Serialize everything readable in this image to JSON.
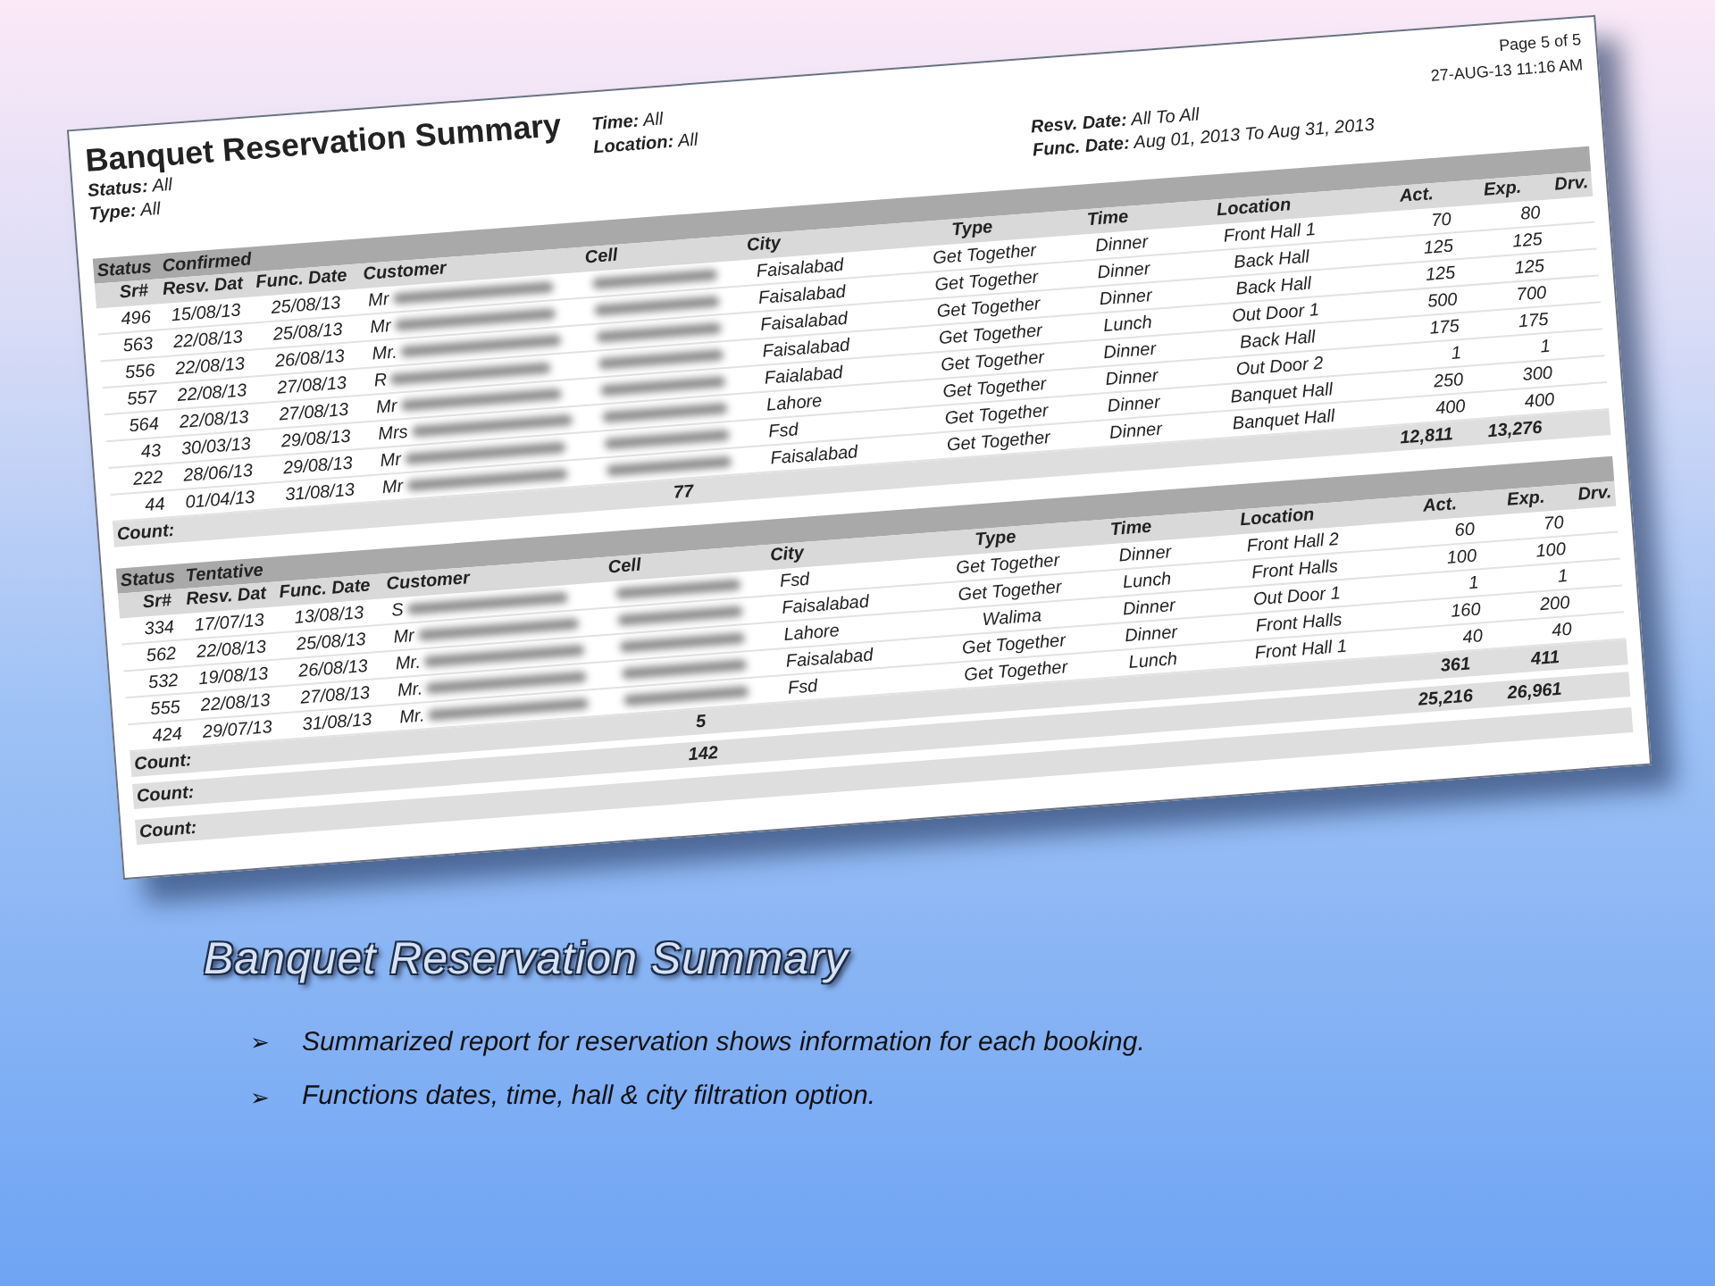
{
  "report": {
    "title": "Banquet Reservation Summary",
    "filters_left": [
      "**Status:** All",
      "**Type:** All"
    ],
    "filters_middle": [
      "**Time:** All",
      "**Location:** All"
    ],
    "filters_right": [
      "**Resv. Date:** All To All",
      "**Func. Date:** Aug 01, 2013 To Aug 31, 2013"
    ],
    "page": "Page 5 of 5",
    "printed": "27-AUG-13 11:16 AM",
    "groups": [
      {
        "status_label": "Status",
        "status": "Confirmed",
        "columns": [
          "Sr#",
          "Resv. Dat",
          "Func. Date",
          "Customer",
          "Cell",
          "City",
          "Type",
          "Time",
          "Location",
          "Act.",
          "Exp.",
          "Drv."
        ],
        "rows": [
          {
            "sr": "496",
            "resv": "15/08/13",
            "func": "25/08/13",
            "customer_prefix": "Mr",
            "city": "Faisalabad",
            "type": "Get Together",
            "time": "Dinner",
            "location": "Front Hall 1",
            "act": "70",
            "exp": "80"
          },
          {
            "sr": "563",
            "resv": "22/08/13",
            "func": "25/08/13",
            "customer_prefix": "Mr",
            "city": "Faisalabad",
            "type": "Get Together",
            "time": "Dinner",
            "location": "Back Hall",
            "act": "125",
            "exp": "125"
          },
          {
            "sr": "556",
            "resv": "22/08/13",
            "func": "26/08/13",
            "customer_prefix": "Mr.",
            "city": "Faisalabad",
            "type": "Get Together",
            "time": "Dinner",
            "location": "Back Hall",
            "act": "125",
            "exp": "125"
          },
          {
            "sr": "557",
            "resv": "22/08/13",
            "func": "27/08/13",
            "customer_prefix": "R",
            "city": "Faisalabad",
            "type": "Get Together",
            "time": "Lunch",
            "location": "Out Door 1",
            "act": "500",
            "exp": "700"
          },
          {
            "sr": "564",
            "resv": "22/08/13",
            "func": "27/08/13",
            "customer_prefix": "Mr",
            "city": "Faialabad",
            "type": "Get Together",
            "time": "Dinner",
            "location": "Back Hall",
            "act": "175",
            "exp": "175"
          },
          {
            "sr": "43",
            "resv": "30/03/13",
            "func": "29/08/13",
            "customer_prefix": "Mrs",
            "city": "Lahore",
            "type": "Get Together",
            "time": "Dinner",
            "location": "Out Door 2",
            "act": "1",
            "exp": "1"
          },
          {
            "sr": "222",
            "resv": "28/06/13",
            "func": "29/08/13",
            "customer_prefix": "Mr",
            "city": "Fsd",
            "type": "Get Together",
            "time": "Dinner",
            "location": "Banquet Hall",
            "act": "250",
            "exp": "300"
          },
          {
            "sr": "44",
            "resv": "01/04/13",
            "func": "31/08/13",
            "customer_prefix": "Mr",
            "city": "Faisalabad",
            "type": "Get Together",
            "time": "Dinner",
            "location": "Banquet Hall",
            "act": "400",
            "exp": "400"
          }
        ],
        "footer": {
          "label": "Count:",
          "count": "77",
          "act": "12,811",
          "exp": "13,276"
        }
      },
      {
        "status_label": "Status",
        "status": "Tentative",
        "columns": [
          "Sr#",
          "Resv. Dat",
          "Func. Date",
          "Customer",
          "Cell",
          "City",
          "Type",
          "Time",
          "Location",
          "Act.",
          "Exp.",
          "Drv."
        ],
        "rows": [
          {
            "sr": "334",
            "resv": "17/07/13",
            "func": "13/08/13",
            "customer_prefix": "S",
            "city": "Fsd",
            "type": "Get Together",
            "time": "Dinner",
            "location": "Front Hall 2",
            "act": "60",
            "exp": "70"
          },
          {
            "sr": "562",
            "resv": "22/08/13",
            "func": "25/08/13",
            "customer_prefix": "Mr",
            "city": "Faisalabad",
            "type": "Get Together",
            "time": "Lunch",
            "location": "Front Halls",
            "act": "100",
            "exp": "100"
          },
          {
            "sr": "532",
            "resv": "19/08/13",
            "func": "26/08/13",
            "customer_prefix": "Mr.",
            "city": "Lahore",
            "type": "Walima",
            "time": "Dinner",
            "location": "Out Door 1",
            "act": "1",
            "exp": "1"
          },
          {
            "sr": "555",
            "resv": "22/08/13",
            "func": "27/08/13",
            "customer_prefix": "Mr.",
            "city": "Faisalabad",
            "type": "Get Together",
            "time": "Dinner",
            "location": "Front Halls",
            "act": "160",
            "exp": "200"
          },
          {
            "sr": "424",
            "resv": "29/07/13",
            "func": "31/08/13",
            "customer_prefix": "Mr.",
            "city": "Fsd",
            "type": "Get Together",
            "time": "Lunch",
            "location": "Front Hall 1",
            "act": "40",
            "exp": "40"
          }
        ],
        "footer": {
          "label": "Count:",
          "count": "5",
          "act": "361",
          "exp": "411"
        }
      }
    ],
    "grand_total": {
      "label": "Count:",
      "count": "142",
      "act": "25,216",
      "exp": "26,961"
    },
    "final_label": "Count:"
  },
  "slide": {
    "title": "Banquet Reservation Summary",
    "bullets": [
      {
        "marker": "➢",
        "text": "Summarized report for reservation shows information for each booking."
      },
      {
        "marker": "➢",
        "text": "Functions dates, time, hall & city filtration option."
      }
    ]
  }
}
